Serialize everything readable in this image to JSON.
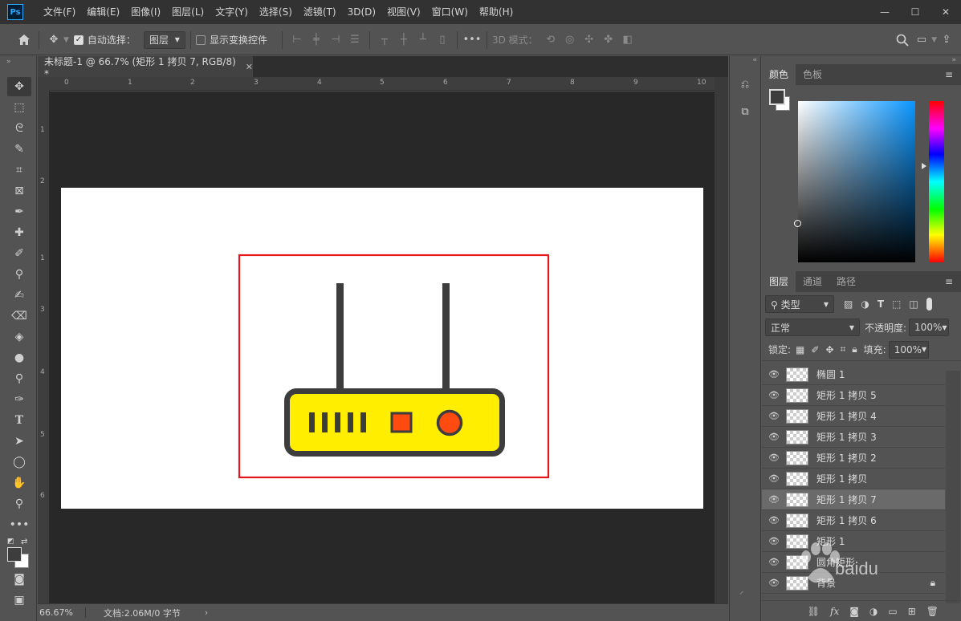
{
  "app": {
    "logo": "Ps",
    "menu": [
      "文件(F)",
      "编辑(E)",
      "图像(I)",
      "图层(L)",
      "文字(Y)",
      "选择(S)",
      "滤镜(T)",
      "3D(D)",
      "视图(V)",
      "窗口(W)",
      "帮助(H)"
    ]
  },
  "options_bar": {
    "auto_select_label": "自动选择：",
    "auto_select_target": "图层",
    "show_transform_label": "显示变换控件",
    "mode_3d_label": "3D 模式："
  },
  "document": {
    "tab_title": "未标题-1 @ 66.7% (矩形 1 拷贝 7, RGB/8) *",
    "ruler_top_ticks": [
      "0",
      "1",
      "2",
      "3",
      "4",
      "5",
      "6",
      "7",
      "8",
      "9",
      "10"
    ],
    "ruler_left_ticks": [
      "1",
      "2",
      "1",
      "3",
      "4",
      "5",
      "6"
    ]
  },
  "status": {
    "zoom": "66.67%",
    "doc_info": "文档:2.06M/0 字节"
  },
  "color_panel": {
    "tabs": [
      "颜色",
      "色板"
    ],
    "active_tab": "颜色"
  },
  "layers_panel": {
    "tabs": [
      "图层",
      "通道",
      "路径"
    ],
    "filter_label": "类型",
    "blend_mode": "正常",
    "opacity_label": "不透明度:",
    "opacity_value": "100%",
    "lock_label": "锁定:",
    "fill_label": "填充:",
    "fill_value": "100%",
    "layers": [
      {
        "name": "椭圆 1"
      },
      {
        "name": "矩形 1 拷贝 5"
      },
      {
        "name": "矩形 1 拷贝 4"
      },
      {
        "name": "矩形 1 拷贝 3"
      },
      {
        "name": "矩形 1 拷贝 2"
      },
      {
        "name": "矩形 1 拷贝"
      },
      {
        "name": "矩形 1 拷贝 7"
      },
      {
        "name": "矩形 1 拷贝 6"
      },
      {
        "name": "矩形 1"
      },
      {
        "name": "圆角矩形"
      },
      {
        "name": "背景"
      }
    ],
    "selected_index": 6
  },
  "watermark": "baidu",
  "colors": {
    "router_body": "#ffee00",
    "router_outline": "#3d3d3d",
    "router_accent": "#ff4a10",
    "selection_box": "#e8141b"
  }
}
